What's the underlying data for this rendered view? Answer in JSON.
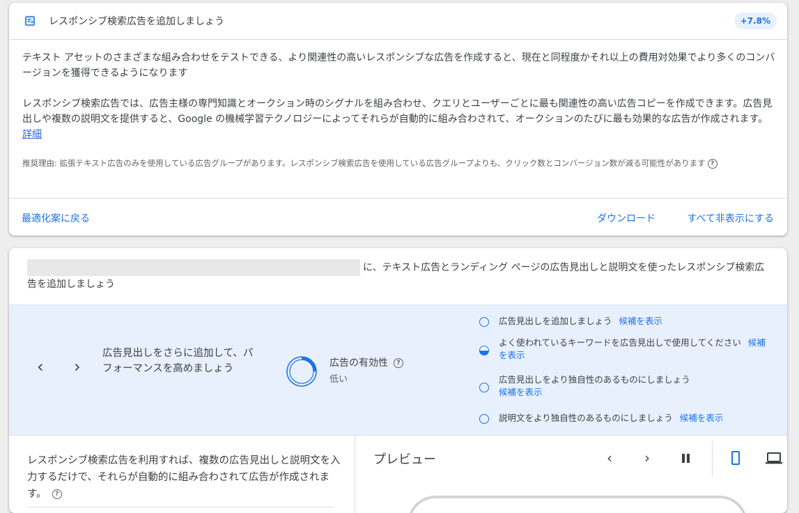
{
  "recommendation": {
    "title": "レスポンシブ検索広告を追加しましょう",
    "uplift": "+7.8%",
    "paragraph1": "テキスト アセットのさまざまな組み合わせをテストできる、より関連性の高いレスポンシブな広告を作成すると、現在と同程度かそれ以上の費用対効果でより多くのコンバージョンを獲得できるようになります",
    "paragraph2": "レスポンシブ検索広告では、広告主様の専門知識とオークション時のシグナルを組み合わせ、クエリとユーザーごとに最も関連性の高い広告コピーを作成できます。広告見出しや複数の説明文を提供すると、Google の機械学習テクノロジーによってそれらが自動的に組み合わされて、オークションのたびに最も効果的な広告が作成されます。",
    "details_link": "詳細",
    "reason": "推奨理由: 拡張テキスト広告のみを使用している広告グループがあります。レスポンシブ検索広告を使用している広告グループよりも、クリック数とコンバージョン数が減る可能性があります",
    "help_glyph": "?",
    "footer": {
      "back": "最適化案に戻る",
      "download": "ダウンロード",
      "hide_all": "すべて非表示にする"
    }
  },
  "editor": {
    "headline_suffix": "に、テキスト広告とランディング ページの広告見出しと説明文を使ったレスポンシブ検索広告を追加しましょう",
    "prev": "‹",
    "next": "›",
    "improve_text": "広告見出しをさらに追加して、パフォーマンスを高めましょう",
    "ad_strength_label": "広告の有効性",
    "ad_strength_value": "低い",
    "ad_strength_fraction": 0.25,
    "suggestions": [
      {
        "text": "広告見出しを追加しましょう",
        "link": "候補を表示",
        "state": "empty"
      },
      {
        "text": "よく使われているキーワードを広告見出しで使用してください",
        "link": "候補を表示",
        "state": "half"
      },
      {
        "text": "広告見出しをより独自性のあるものにしましょう",
        "link": "候補を表示",
        "state": "empty"
      },
      {
        "text": "説明文をより独自性のあるものにしましょう",
        "link": "候補を表示",
        "state": "empty"
      }
    ],
    "info_text": "レスポンシブ検索広告を利用すれば、複数の広告見出しと説明文を入力するだけで、それらが自動的に組み合わされて広告が作成されます。",
    "preview_title": "プレビュー",
    "preview_prev": "‹",
    "preview_next": "›"
  },
  "colors": {
    "accent": "#1a73e8",
    "panel": "#e8f0fe",
    "background": "#eeeeee"
  }
}
